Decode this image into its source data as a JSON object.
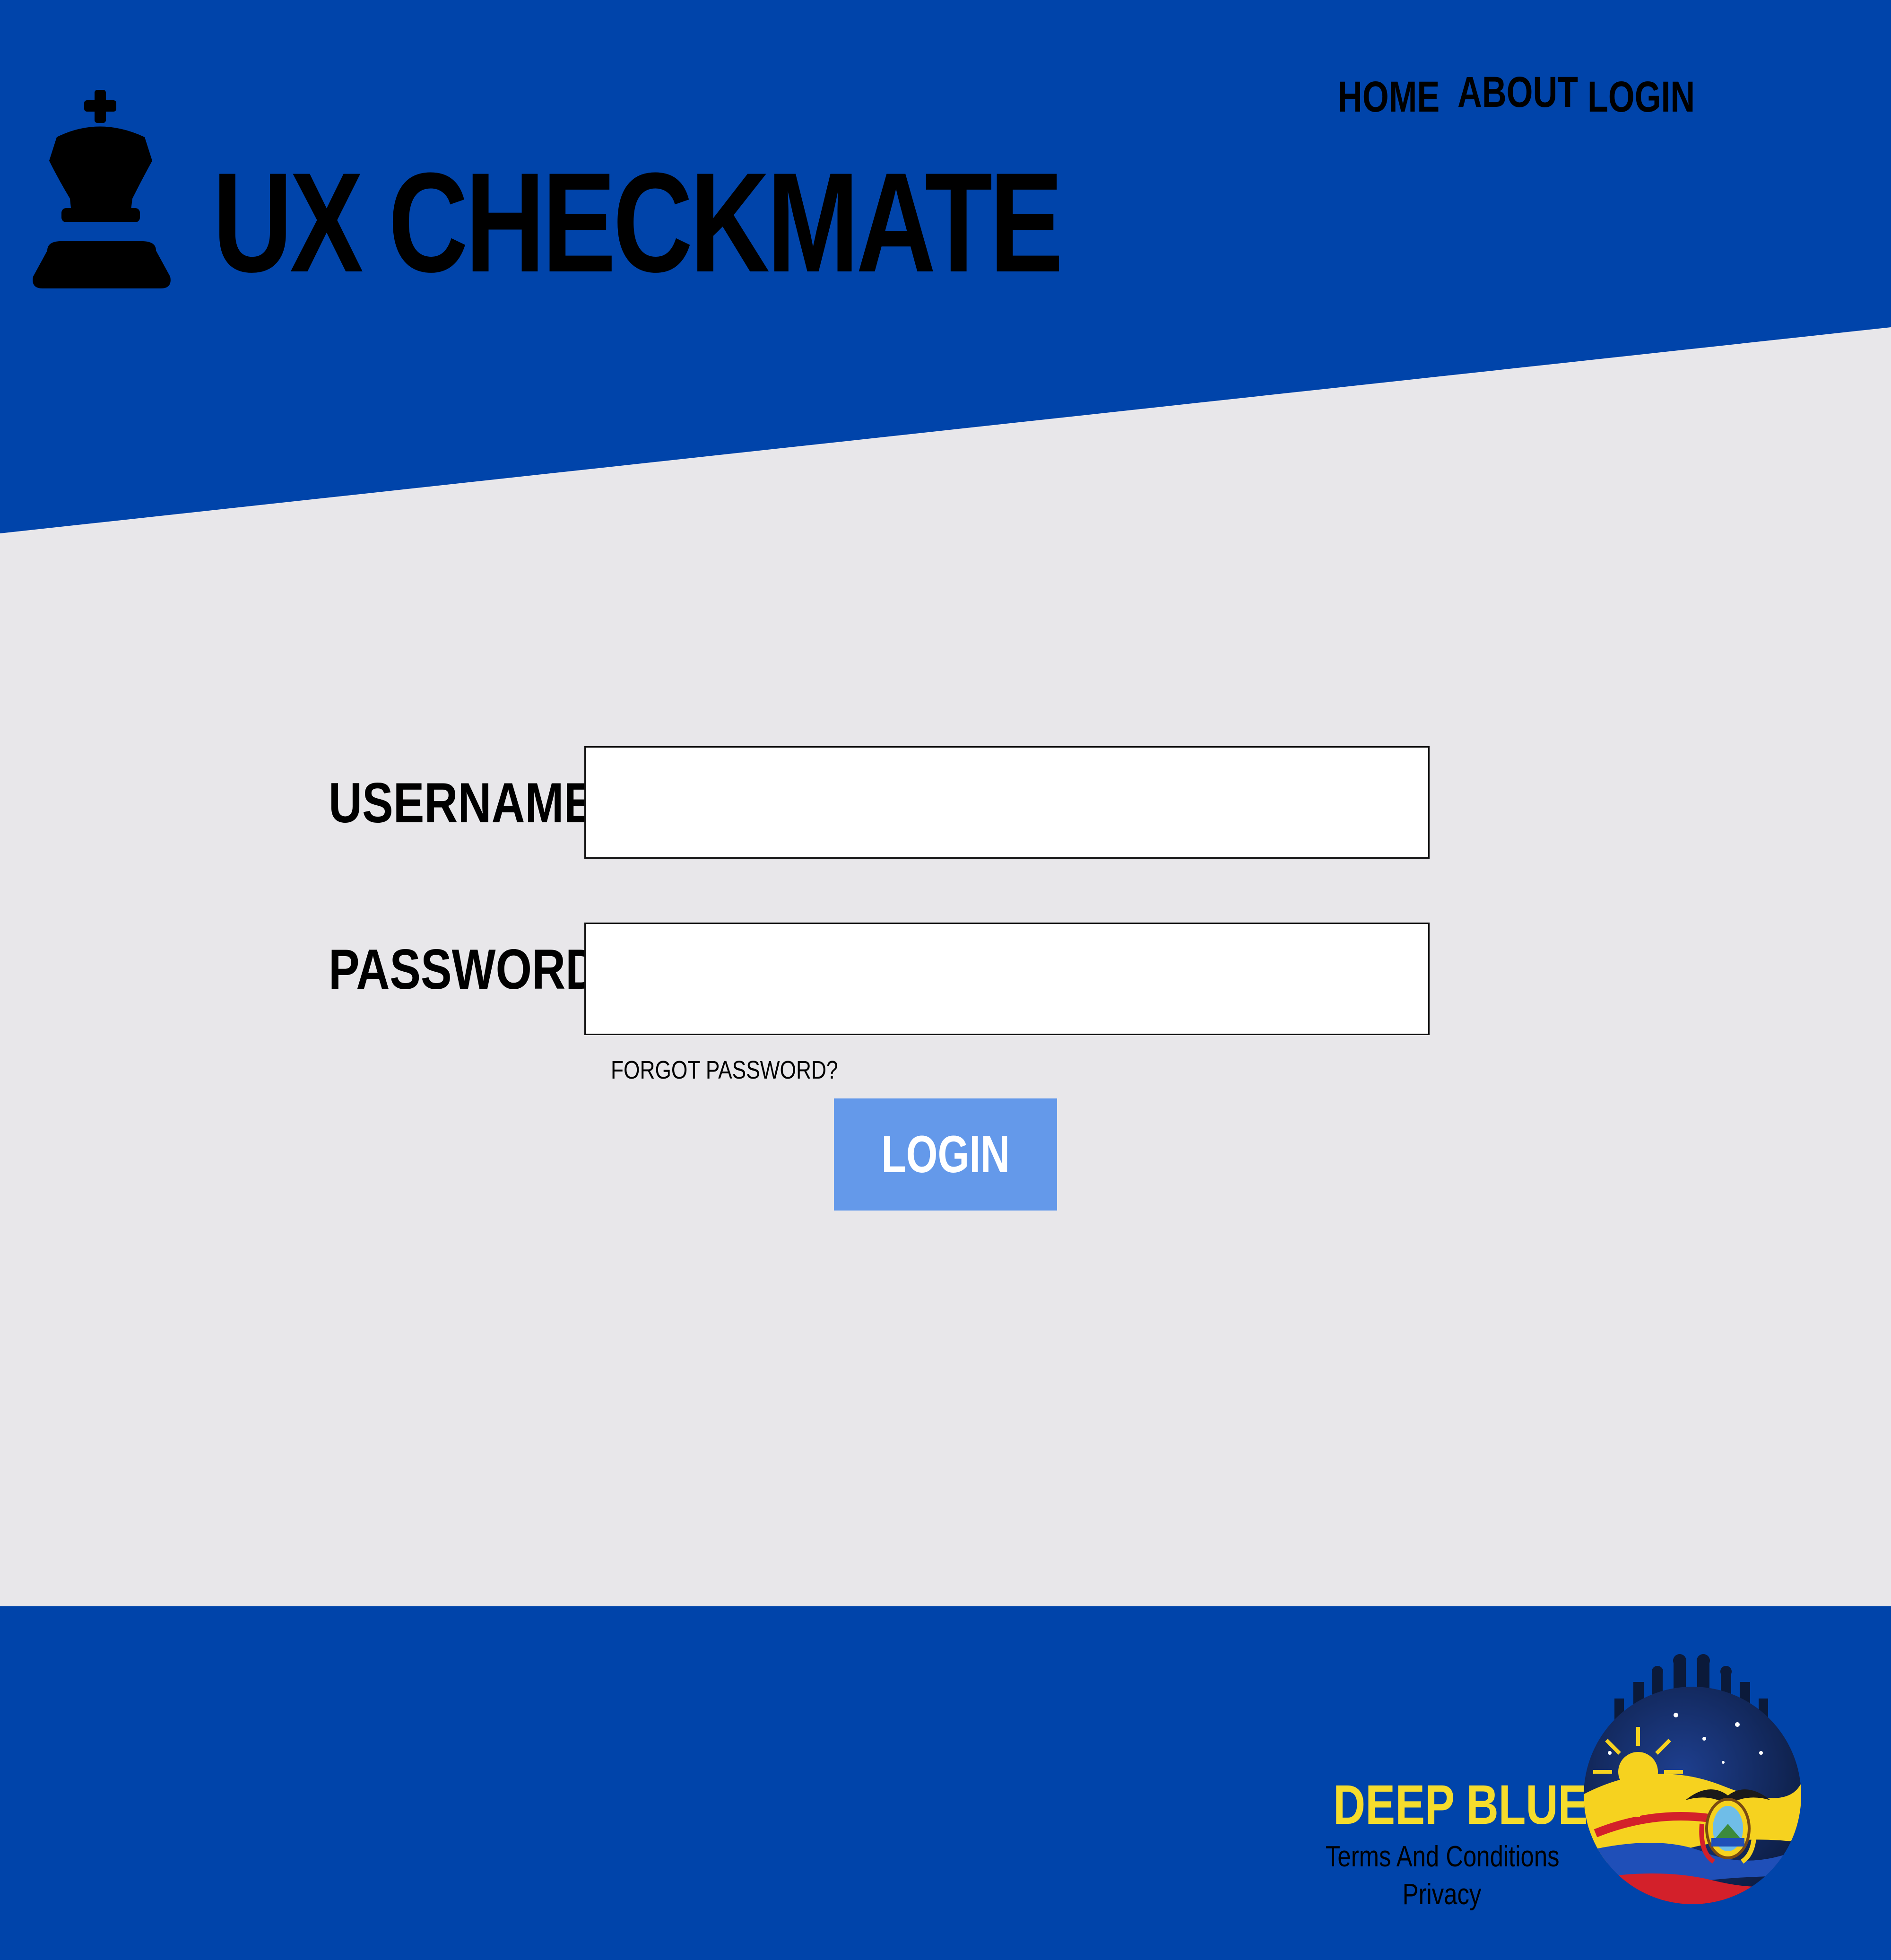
{
  "header": {
    "brand": "UX CHECKMATE",
    "nav": [
      {
        "label": "HOME"
      },
      {
        "label": "ABOUT"
      },
      {
        "label": "LOGIN"
      }
    ]
  },
  "form": {
    "username_label": "USERNAME",
    "username_value": "",
    "password_label": "PASSWORD",
    "password_value": "",
    "forgot_password": "FORGOT PASSWORD?",
    "login_button": "LOGIN"
  },
  "footer": {
    "brand": "DEEP BLUE",
    "terms": "Terms And Conditions",
    "privacy": "Privacy"
  },
  "colors": {
    "primary_blue": "#0044aa",
    "background": "#e8e7ea",
    "button": "#6499ea",
    "footer_brand": "#f5dc2c"
  },
  "icons": {
    "logo": "chess-king-icon",
    "emblem": "deep-blue-emblem-icon"
  }
}
